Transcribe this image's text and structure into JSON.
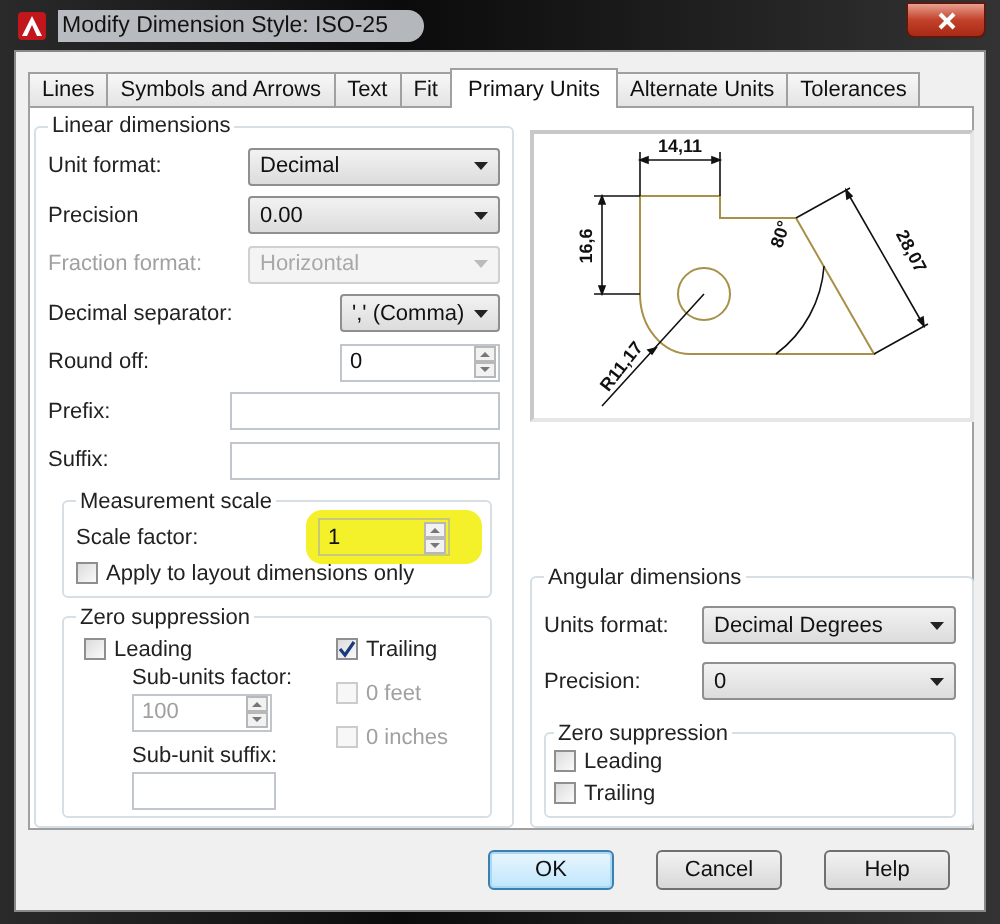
{
  "window": {
    "title": "Modify Dimension Style: ISO-25"
  },
  "tabs": [
    {
      "label": "Lines",
      "selected": false
    },
    {
      "label": "Symbols and Arrows",
      "selected": false
    },
    {
      "label": "Text",
      "selected": false
    },
    {
      "label": "Fit",
      "selected": false
    },
    {
      "label": "Primary Units",
      "selected": true
    },
    {
      "label": "Alternate Units",
      "selected": false
    },
    {
      "label": "Tolerances",
      "selected": false
    }
  ],
  "linear_dimensions": {
    "title": "Linear dimensions",
    "fields": [
      {
        "label": "Unit format:",
        "kind": "dropdown",
        "value": "Decimal",
        "disabled": false
      },
      {
        "label": "Precision",
        "kind": "dropdown",
        "value": "0.00",
        "disabled": false
      },
      {
        "label": "Fraction format:",
        "kind": "dropdown",
        "value": "Horizontal",
        "disabled": true
      },
      {
        "label": "Decimal separator:",
        "kind": "short-dropdown",
        "value": "',' (Comma)",
        "disabled": false
      },
      {
        "label": "Round off:",
        "kind": "spinner",
        "value": "0",
        "disabled": false
      },
      {
        "label": "Prefix:",
        "kind": "text",
        "disabled": false
      },
      {
        "label": "Suffix:",
        "kind": "text",
        "disabled": false
      }
    ],
    "measurement_scale": {
      "title": "Measurement scale",
      "scale_factor": {
        "label": "Scale factor:",
        "value": "1"
      },
      "apply_to_layout": {
        "label": "Apply to layout dimensions only",
        "checked": false
      }
    },
    "zero_suppression": {
      "title": "Zero suppression",
      "leading": {
        "label": "Leading",
        "checked": false
      },
      "trailing": {
        "label": "Trailing",
        "checked": true
      },
      "sub_units_factor": {
        "label": "Sub-units factor:",
        "value": "100",
        "disabled": true
      },
      "sub_unit_suffix": {
        "label": "Sub-unit suffix:"
      },
      "feet": {
        "label": "0 feet",
        "checked": false,
        "disabled": true
      },
      "inches": {
        "label": "0 inches",
        "checked": false,
        "disabled": true
      }
    }
  },
  "preview": {
    "labels": [
      "14,11",
      "16,6",
      "28,07",
      "80°",
      "R11,17"
    ]
  },
  "angular_dimensions": {
    "title": "Angular dimensions",
    "units_format": {
      "label": "Units format:",
      "value": "Decimal Degrees"
    },
    "precision": {
      "label": "Precision:",
      "value": "0"
    },
    "zero_suppression": {
      "title": "Zero suppression",
      "leading": {
        "label": "Leading",
        "checked": false
      },
      "trailing": {
        "label": "Trailing",
        "checked": false
      }
    }
  },
  "buttons": [
    {
      "label": "OK",
      "default": true
    },
    {
      "label": "Cancel",
      "default": false
    },
    {
      "label": "Help",
      "default": false
    }
  ]
}
